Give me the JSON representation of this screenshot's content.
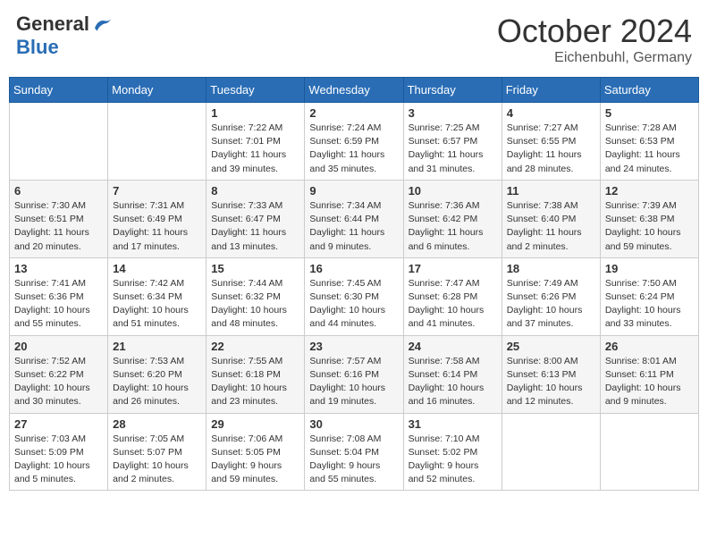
{
  "header": {
    "logo_general": "General",
    "logo_blue": "Blue",
    "month": "October 2024",
    "location": "Eichenbuhl, Germany"
  },
  "weekdays": [
    "Sunday",
    "Monday",
    "Tuesday",
    "Wednesday",
    "Thursday",
    "Friday",
    "Saturday"
  ],
  "weeks": [
    [
      {
        "day": "",
        "detail": ""
      },
      {
        "day": "",
        "detail": ""
      },
      {
        "day": "1",
        "detail": "Sunrise: 7:22 AM\nSunset: 7:01 PM\nDaylight: 11 hours and 39 minutes."
      },
      {
        "day": "2",
        "detail": "Sunrise: 7:24 AM\nSunset: 6:59 PM\nDaylight: 11 hours and 35 minutes."
      },
      {
        "day": "3",
        "detail": "Sunrise: 7:25 AM\nSunset: 6:57 PM\nDaylight: 11 hours and 31 minutes."
      },
      {
        "day": "4",
        "detail": "Sunrise: 7:27 AM\nSunset: 6:55 PM\nDaylight: 11 hours and 28 minutes."
      },
      {
        "day": "5",
        "detail": "Sunrise: 7:28 AM\nSunset: 6:53 PM\nDaylight: 11 hours and 24 minutes."
      }
    ],
    [
      {
        "day": "6",
        "detail": "Sunrise: 7:30 AM\nSunset: 6:51 PM\nDaylight: 11 hours and 20 minutes."
      },
      {
        "day": "7",
        "detail": "Sunrise: 7:31 AM\nSunset: 6:49 PM\nDaylight: 11 hours and 17 minutes."
      },
      {
        "day": "8",
        "detail": "Sunrise: 7:33 AM\nSunset: 6:47 PM\nDaylight: 11 hours and 13 minutes."
      },
      {
        "day": "9",
        "detail": "Sunrise: 7:34 AM\nSunset: 6:44 PM\nDaylight: 11 hours and 9 minutes."
      },
      {
        "day": "10",
        "detail": "Sunrise: 7:36 AM\nSunset: 6:42 PM\nDaylight: 11 hours and 6 minutes."
      },
      {
        "day": "11",
        "detail": "Sunrise: 7:38 AM\nSunset: 6:40 PM\nDaylight: 11 hours and 2 minutes."
      },
      {
        "day": "12",
        "detail": "Sunrise: 7:39 AM\nSunset: 6:38 PM\nDaylight: 10 hours and 59 minutes."
      }
    ],
    [
      {
        "day": "13",
        "detail": "Sunrise: 7:41 AM\nSunset: 6:36 PM\nDaylight: 10 hours and 55 minutes."
      },
      {
        "day": "14",
        "detail": "Sunrise: 7:42 AM\nSunset: 6:34 PM\nDaylight: 10 hours and 51 minutes."
      },
      {
        "day": "15",
        "detail": "Sunrise: 7:44 AM\nSunset: 6:32 PM\nDaylight: 10 hours and 48 minutes."
      },
      {
        "day": "16",
        "detail": "Sunrise: 7:45 AM\nSunset: 6:30 PM\nDaylight: 10 hours and 44 minutes."
      },
      {
        "day": "17",
        "detail": "Sunrise: 7:47 AM\nSunset: 6:28 PM\nDaylight: 10 hours and 41 minutes."
      },
      {
        "day": "18",
        "detail": "Sunrise: 7:49 AM\nSunset: 6:26 PM\nDaylight: 10 hours and 37 minutes."
      },
      {
        "day": "19",
        "detail": "Sunrise: 7:50 AM\nSunset: 6:24 PM\nDaylight: 10 hours and 33 minutes."
      }
    ],
    [
      {
        "day": "20",
        "detail": "Sunrise: 7:52 AM\nSunset: 6:22 PM\nDaylight: 10 hours and 30 minutes."
      },
      {
        "day": "21",
        "detail": "Sunrise: 7:53 AM\nSunset: 6:20 PM\nDaylight: 10 hours and 26 minutes."
      },
      {
        "day": "22",
        "detail": "Sunrise: 7:55 AM\nSunset: 6:18 PM\nDaylight: 10 hours and 23 minutes."
      },
      {
        "day": "23",
        "detail": "Sunrise: 7:57 AM\nSunset: 6:16 PM\nDaylight: 10 hours and 19 minutes."
      },
      {
        "day": "24",
        "detail": "Sunrise: 7:58 AM\nSunset: 6:14 PM\nDaylight: 10 hours and 16 minutes."
      },
      {
        "day": "25",
        "detail": "Sunrise: 8:00 AM\nSunset: 6:13 PM\nDaylight: 10 hours and 12 minutes."
      },
      {
        "day": "26",
        "detail": "Sunrise: 8:01 AM\nSunset: 6:11 PM\nDaylight: 10 hours and 9 minutes."
      }
    ],
    [
      {
        "day": "27",
        "detail": "Sunrise: 7:03 AM\nSunset: 5:09 PM\nDaylight: 10 hours and 5 minutes."
      },
      {
        "day": "28",
        "detail": "Sunrise: 7:05 AM\nSunset: 5:07 PM\nDaylight: 10 hours and 2 minutes."
      },
      {
        "day": "29",
        "detail": "Sunrise: 7:06 AM\nSunset: 5:05 PM\nDaylight: 9 hours and 59 minutes."
      },
      {
        "day": "30",
        "detail": "Sunrise: 7:08 AM\nSunset: 5:04 PM\nDaylight: 9 hours and 55 minutes."
      },
      {
        "day": "31",
        "detail": "Sunrise: 7:10 AM\nSunset: 5:02 PM\nDaylight: 9 hours and 52 minutes."
      },
      {
        "day": "",
        "detail": ""
      },
      {
        "day": "",
        "detail": ""
      }
    ]
  ]
}
